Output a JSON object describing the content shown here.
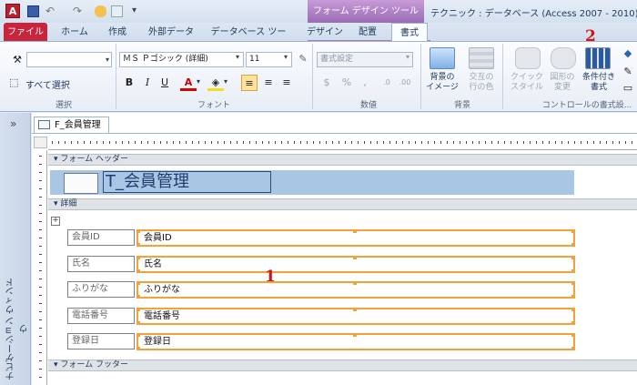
{
  "title_bar": {
    "context_tab": "フォーム デザイン ツール",
    "window_title": "テクニック : データベース (Access 2007 - 2010) - ..."
  },
  "tabs": [
    "ファイル",
    "ホーム",
    "作成",
    "外部データ",
    "データベース ツール",
    "デザイン",
    "配置",
    "書式"
  ],
  "ribbon": {
    "selection": {
      "select_all": "すべて選択",
      "group": "選択"
    },
    "font": {
      "font_name": "ＭＳ Ｐゴシック (詳細)",
      "font_size": "11",
      "group": "フォント"
    },
    "number": {
      "format": "書式設定",
      "group": "数値"
    },
    "background": {
      "bg_image": "背景の\nイメージ",
      "alt_row": "交互の\n行の色",
      "group": "背景"
    },
    "control_format": {
      "quick_style": "クイック\nスタイル",
      "change_shape": "図形の\n変更",
      "conditional": "条件付き\n書式",
      "group": "コントロールの書式設..."
    }
  },
  "annotations": {
    "one": "1",
    "two": "2"
  },
  "nav_pane_label": "ナビゲーション ウィンドウ",
  "document": {
    "tab_title": "F_会員管理",
    "sections": {
      "header": "フォーム ヘッダー",
      "detail": "詳細",
      "footer": "フォーム フッター"
    },
    "form_title": "T_会員管理",
    "fields": [
      {
        "label": "会員ID",
        "control": "会員ID"
      },
      {
        "label": "氏名",
        "control": "氏名"
      },
      {
        "label": "ふりがな",
        "control": "ふりがな"
      },
      {
        "label": "電話番号",
        "control": "電話番号"
      },
      {
        "label": "登録日",
        "control": "登録日"
      }
    ]
  },
  "colors": {
    "file_tab": "#c8243b",
    "context_tab": "#a77bbf",
    "selection": "#f3a13b",
    "header_band": "#a9c6e4",
    "annotation": "#d01515"
  }
}
